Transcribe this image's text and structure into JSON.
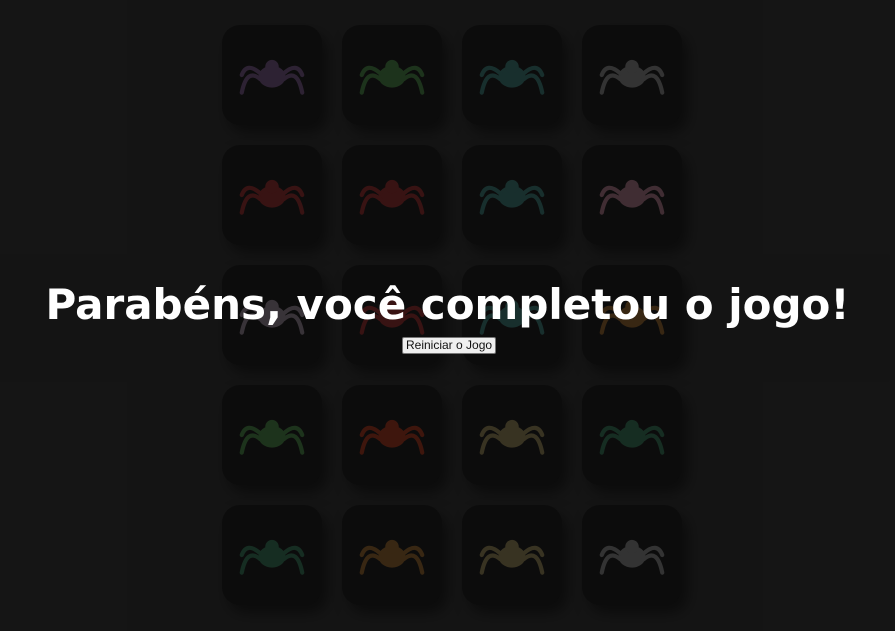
{
  "game": {
    "win_message": "Parabéns, você completou o jogo!",
    "restart_label": "Reiniciar o Jogo"
  },
  "board": {
    "rows": 5,
    "columns": 4,
    "cards": [
      {
        "creature": "purple-spider-creature-icon",
        "color": "#6b4a7a"
      },
      {
        "creature": "green-tentacle-creature-icon",
        "color": "#3e7a3a"
      },
      {
        "creature": "teal-spiked-creature-icon",
        "color": "#2f6e6a"
      },
      {
        "creature": "silver-sphere-creature-icon",
        "color": "#7a7a7a"
      },
      {
        "creature": "red-crab-creature-icon",
        "color": "#8a2020"
      },
      {
        "creature": "red-crab-creature-icon",
        "color": "#8a2020"
      },
      {
        "creature": "teal-spiked-creature-icon",
        "color": "#2f6e6a"
      },
      {
        "creature": "pink-clawed-creature-icon",
        "color": "#a06a7a"
      },
      {
        "creature": "pale-winged-creature-icon",
        "color": "#8a7a8a"
      },
      {
        "creature": "red-crab-creature-icon",
        "color": "#8a2020"
      },
      {
        "creature": "teal-spiked-creature-icon",
        "color": "#2f6e6a"
      },
      {
        "creature": "orange-beetle-creature-icon",
        "color": "#8a5a20"
      },
      {
        "creature": "green-tentacle-creature-icon",
        "color": "#3e7a3a"
      },
      {
        "creature": "red-flame-creature-icon",
        "color": "#9a2a10"
      },
      {
        "creature": "gold-shell-creature-icon",
        "color": "#8a7a4a"
      },
      {
        "creature": "green-dragon-creature-icon",
        "color": "#2a6a4a"
      },
      {
        "creature": "green-dragon-creature-icon",
        "color": "#2a6a4a"
      },
      {
        "creature": "orange-beetle-creature-icon",
        "color": "#8a5a20"
      },
      {
        "creature": "gold-shell-creature-icon",
        "color": "#8a7a4a"
      },
      {
        "creature": "silver-sphere-creature-icon",
        "color": "#7a7a7a"
      }
    ]
  },
  "colors": {
    "background": "#1a1a1a",
    "card": "#0d0d0d",
    "message": "#ffffff"
  }
}
